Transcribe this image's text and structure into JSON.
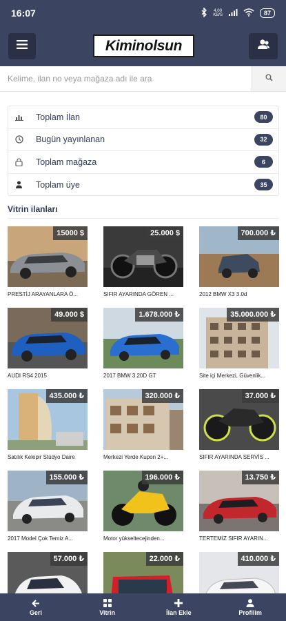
{
  "status_bar": {
    "time": "16:07",
    "network_speed": "4.00\nKB/S",
    "battery": "87"
  },
  "header": {
    "logo": "Kiminolsun",
    "menu_icon": "hamburger-icon",
    "user_icon": "users-icon"
  },
  "search": {
    "placeholder": "Kelime, ilan no veya mağaza adı ile ara",
    "icon": "search-icon"
  },
  "stats": [
    {
      "label": "Toplam İlan",
      "count": "80",
      "icon": "bar-chart-icon"
    },
    {
      "label": "Bugün yayınlanan",
      "count": "32",
      "icon": "clock-icon"
    },
    {
      "label": "Toplam mağaza",
      "count": "6",
      "icon": "lock-icon"
    },
    {
      "label": "Toplam üye",
      "count": "35",
      "icon": "user-icon"
    }
  ],
  "showcase": {
    "title": "Vitrin ilanları",
    "listings": [
      {
        "price": "15000 $",
        "title": "PRESTİJ ARAYANLARA Ö..."
      },
      {
        "price": "25.000 $",
        "title": "SIFIR AYARINDA GÖREN ..."
      },
      {
        "price": "700.000 ₺",
        "title": "2012 BMW X3 3.0d"
      },
      {
        "price": "49.000 $",
        "title": "AUDI RS4 2015"
      },
      {
        "price": "1.678.000 ₺",
        "title": "2017 BMW 3.20D GT"
      },
      {
        "price": "35.000.000 ₺",
        "title": "Site içi Merkezi, Güvenlik..."
      },
      {
        "price": "435.000 ₺",
        "title": "Satılık Kelepir Stüdyo Daire"
      },
      {
        "price": "320.000 ₺",
        "title": "Merkezi Yerde Kupon 2+..."
      },
      {
        "price": "37.000 ₺",
        "title": "SIFIR AYARINDA SERVİS ..."
      },
      {
        "price": "155.000 ₺",
        "title": "2017 Model Çok Temiz A..."
      },
      {
        "price": "196.000 ₺",
        "title": "Motor yükseltecejinden..."
      },
      {
        "price": "13.750 ₺",
        "title": "TERTEMİZ SIFIR AYARIN..."
      },
      {
        "price": "57.000 ₺",
        "title": ""
      },
      {
        "price": "22.000 ₺",
        "title": ""
      },
      {
        "price": "410.000 ₺",
        "title": ""
      }
    ]
  },
  "bottom_nav": [
    {
      "label": "Geri",
      "icon": "arrow-left-icon"
    },
    {
      "label": "Vitrin",
      "icon": "grid-icon"
    },
    {
      "label": "İlan Ekle",
      "icon": "plus-icon"
    },
    {
      "label": "Profilim",
      "icon": "user-icon"
    }
  ]
}
